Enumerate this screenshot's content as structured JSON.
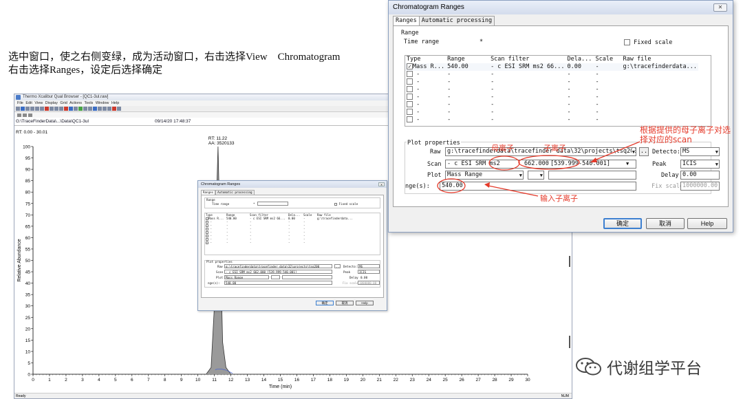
{
  "instructions": {
    "line1": "选中窗口，使之右侧变绿，成为活动窗口，右击选择View    Chromatogram",
    "line2": "右击选择Ranges，设定后选择确定"
  },
  "app": {
    "title": "Thermo Xcalibur Qual Browser - [QC1-3ul.raw]",
    "menu": [
      "File",
      "Edit",
      "View",
      "Display",
      "Grid",
      "Actions",
      "Tools",
      "Window",
      "Help"
    ],
    "file_path": "G:\\TraceFinderData\\...\\Data\\QC1-3ul",
    "timestamp": "09/14/20 17:48:37",
    "rt_range": "RT: 0.00 - 30.01",
    "peak_rt": "RT: 11.22",
    "peak_aa": "AA: 3520133",
    "status_left": "Ready",
    "status_right": "NUM"
  },
  "chart_data": {
    "type": "line",
    "xlabel": "Time (min)",
    "ylabel": "Relative Abundance",
    "xlim": [
      0,
      30
    ],
    "ylim": [
      0,
      100
    ],
    "x_ticks": [
      0,
      1,
      2,
      3,
      4,
      5,
      6,
      7,
      8,
      9,
      10,
      11,
      12,
      13,
      14,
      15,
      16,
      17,
      18,
      19,
      20,
      21,
      22,
      23,
      24,
      25,
      26,
      27,
      28,
      29,
      30
    ],
    "y_ticks": [
      0,
      5,
      10,
      15,
      20,
      25,
      30,
      35,
      40,
      45,
      50,
      55,
      60,
      65,
      70,
      75,
      80,
      85,
      90,
      95,
      100
    ],
    "series": [
      {
        "x": [
          0,
          10.5,
          10.8,
          11.0,
          11.1,
          11.22,
          11.35,
          11.5,
          11.7,
          12.0,
          30
        ],
        "y": [
          0,
          0,
          3,
          30,
          70,
          100,
          60,
          14,
          3,
          0,
          0
        ]
      }
    ],
    "annotations": [
      "RT: 11.22",
      "AA: 3520133"
    ]
  },
  "dialog": {
    "title": "Chromatogram Ranges",
    "tabs": [
      "Ranges",
      "Automatic processing"
    ],
    "range_group": "Range",
    "time_range_label": "Time range",
    "time_range_value": "*",
    "fixed_scale_label": "Fixed scale",
    "columns": [
      "Type",
      "Range",
      "Scan filter",
      "Dela...",
      "Scale",
      "Raw file"
    ],
    "row1": {
      "type": "Mass R...",
      "range": "540.00",
      "scan_filter": "- c ESI SRM ms2 66...",
      "delay": "0.00",
      "scale": "-",
      "raw_file": "g:\\tracefinderdata..."
    },
    "empty_rows": 7,
    "dash": "-",
    "plot_group": "Plot properties",
    "raw_label": "Raw",
    "raw_value": "g:\\tracefinderdata\\tracefinder data\\32\\projects\\tsq200",
    "browse_label": "..",
    "detector_label": "Detecto:",
    "detector_value": "MS",
    "scan_label": "Scan",
    "scan_value_prefix": "- c ESI SRM ms2",
    "scan_parent": "662.000",
    "scan_range": "[539.999-540.001]",
    "peak_label": "Peak",
    "peak_value": "ICIS",
    "plot_label": "Plot",
    "plot_value": "Mass Range",
    "delay_label": "Delay",
    "delay_value": "0.00",
    "ranges_label": "nge(s):",
    "ranges_value": "540.00",
    "fix_scale_label": "Fix scale",
    "fix_scale_value": "1000000.00",
    "ok": "确定",
    "cancel": "取消",
    "help": "Help"
  },
  "small_dialog": {
    "scan_value": "- c ESI SRM ms2 662.000 [539.999-540.001]"
  },
  "annotations": {
    "parent_ion": "母离子",
    "child_ion": "子离子",
    "select_scan": "根据提供的母子离子对选择对应的scan",
    "input_child": "输入子离子"
  },
  "watermark": "代谢组学平台"
}
